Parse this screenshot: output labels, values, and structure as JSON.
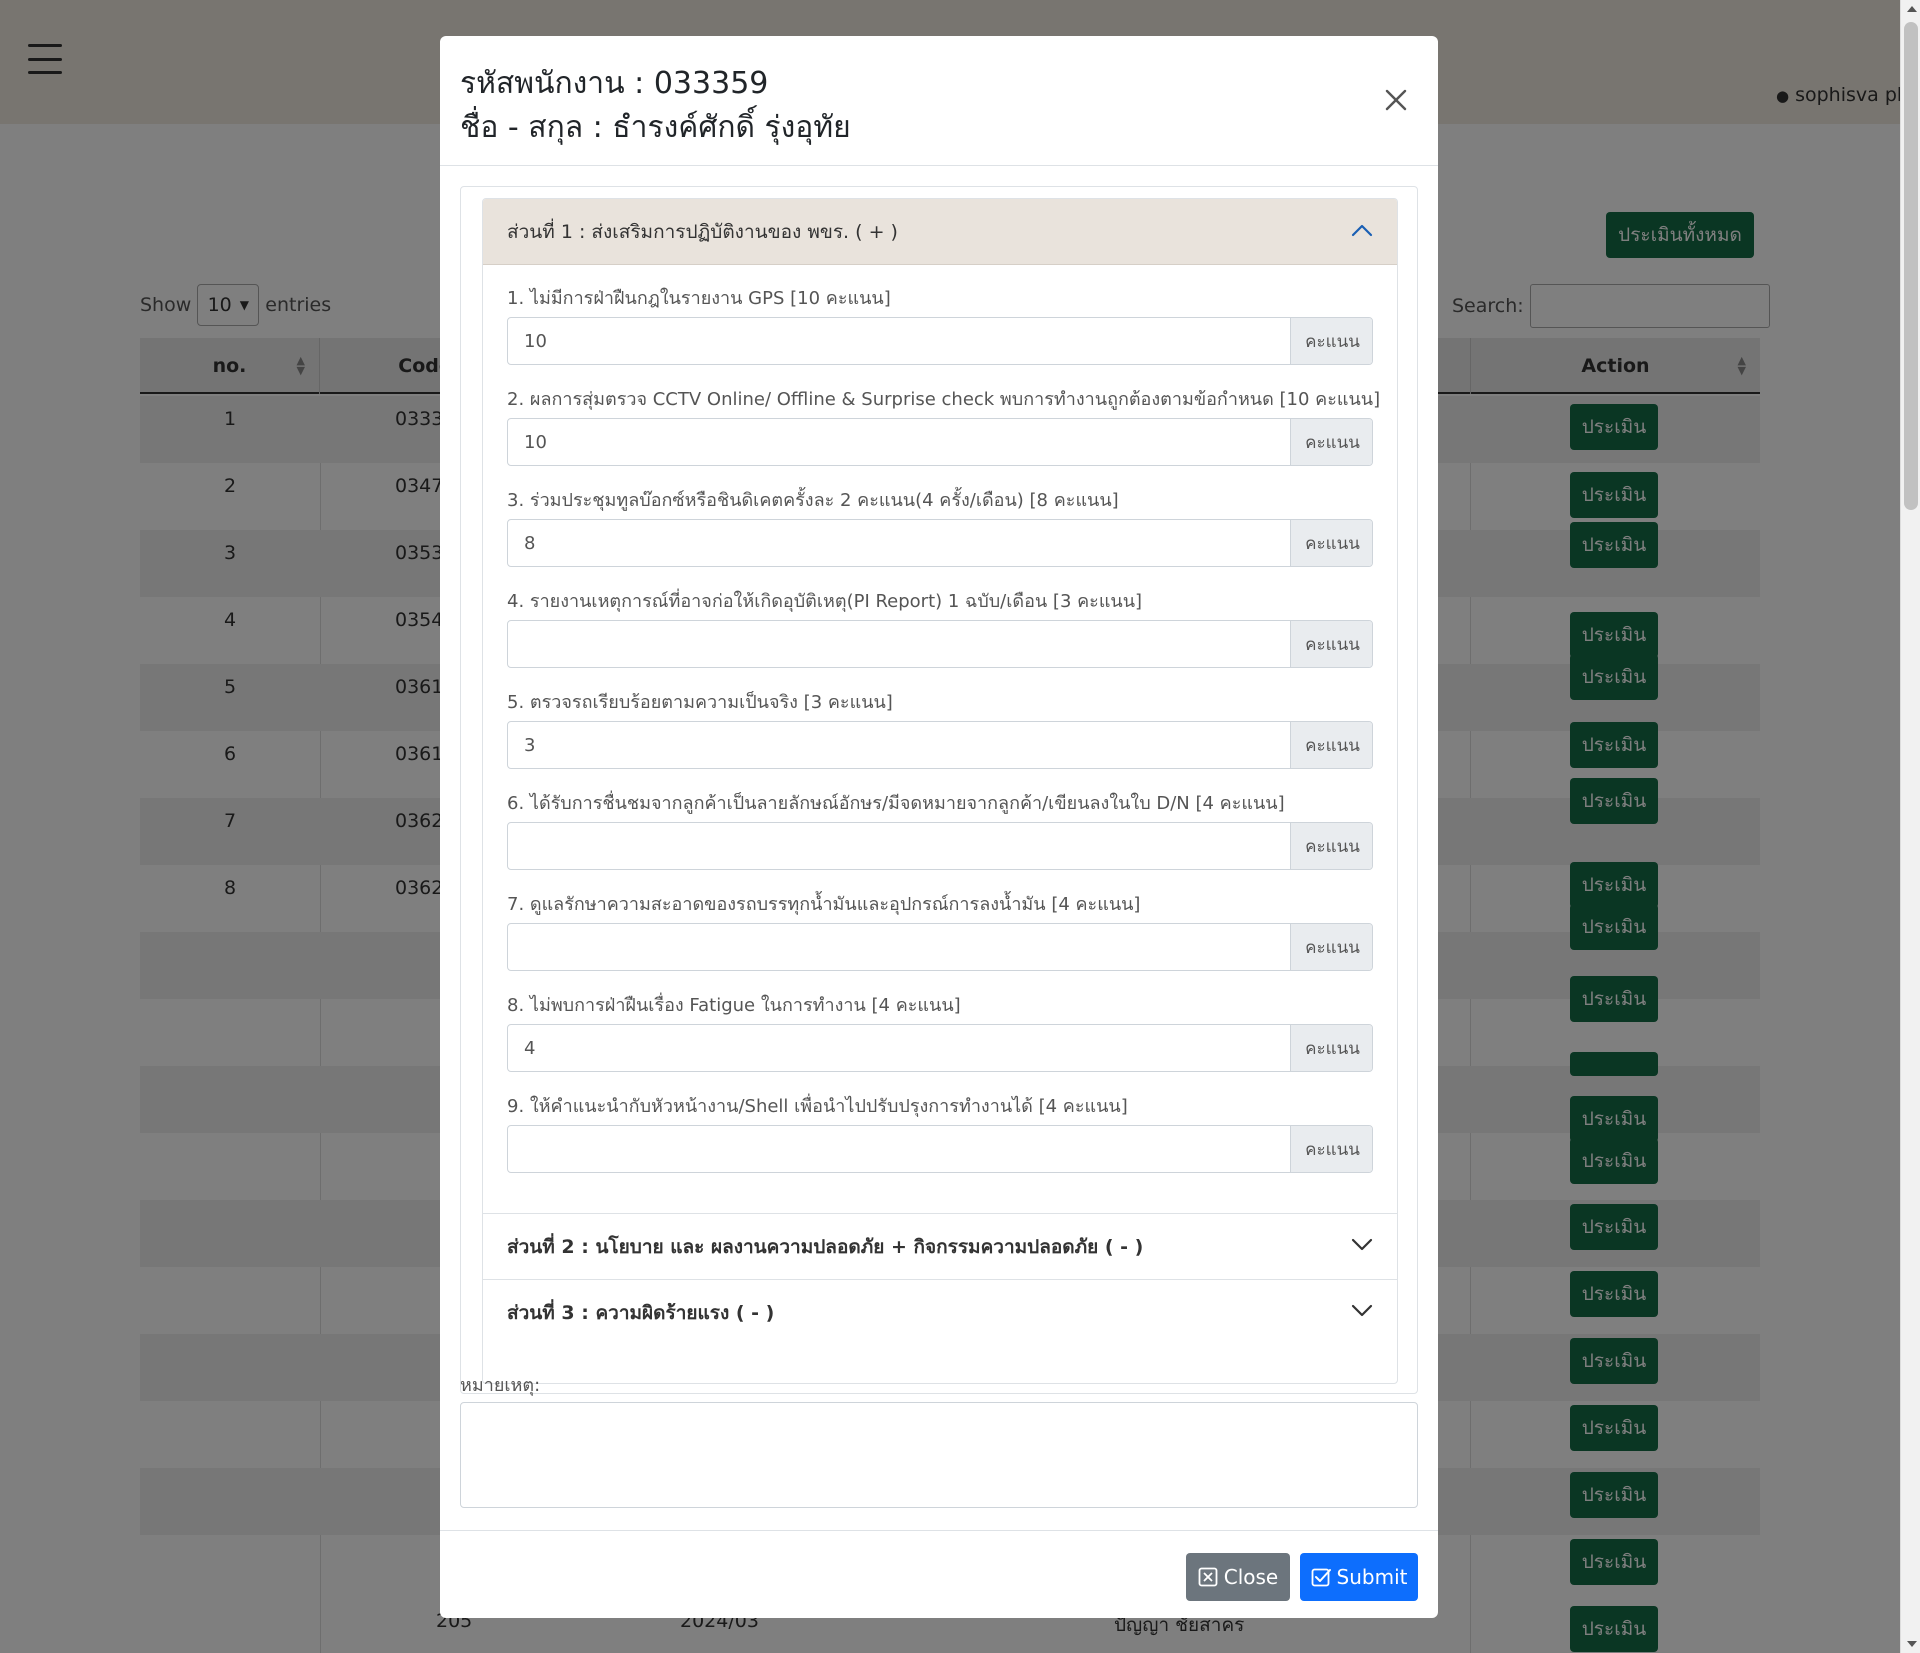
{
  "page": {
    "user_name": "sophisva ph",
    "evaluate_all_label": "ประเมินทั้งหมด",
    "show_label": "Show",
    "entries_value": "10",
    "entries_label": "entries",
    "search_label": "Search:",
    "columns": {
      "no": "no.",
      "code": "Code",
      "action": "Action"
    },
    "rows": [
      {
        "no": "1",
        "code": "0333"
      },
      {
        "no": "2",
        "code": "0347"
      },
      {
        "no": "3",
        "code": "0353"
      },
      {
        "no": "4",
        "code": "0354"
      },
      {
        "no": "5",
        "code": "0361"
      },
      {
        "no": "6",
        "code": "0361"
      },
      {
        "no": "7",
        "code": "0362"
      },
      {
        "no": "8",
        "code": "0362"
      }
    ],
    "action_label": "ประเมิน",
    "bottom_row": {
      "no": "205",
      "period": "2024/03",
      "name": "ปัญญา ชัยสาคร"
    }
  },
  "modal": {
    "employee_id_label": "รหัสพนักงาน :",
    "employee_id": "033359",
    "name_label": "ชื่อ - สกุล :",
    "name": "ธำรงค์ศักดิ์ รุ่งอุทัย",
    "section1_title": "ส่วนที่ 1 : ส่งเสริมการปฏิบัติงานของ พขร. ( + )",
    "section2_title": "ส่วนที่ 2 : นโยบาย และ ผลงานความปลอดภัย + กิจกรรมความปลอดภัย ( - )",
    "section3_title": "ส่วนที่ 3 : ความผิดร้ายแรง ( - )",
    "unit": "คะแนน",
    "questions": [
      {
        "label": "1. ไม่มีการฝ่าฝืนกฎในรายงาน GPS [10 คะแนน]",
        "value": "10"
      },
      {
        "label": "2. ผลการสุ่มตรวจ CCTV Online/ Offline & Surprise check พบการทำงานถูกต้องตามข้อกำหนด [10 คะแนน]",
        "value": "10"
      },
      {
        "label": "3. ร่วมประชุมทูลบ๊อกซ์หรือชินดิเคตครั้งละ 2 คะแนน(4 ครั้ง/เดือน) [8 คะแนน]",
        "value": "8"
      },
      {
        "label": "4. รายงานเหตุการณ์ที่อาจก่อให้เกิดอุบัติเหตุ(PI Report) 1 ฉบับ/เดือน [3 คะแนน]",
        "value": ""
      },
      {
        "label": "5. ตรวจรถเรียบร้อยตามความเป็นจริง [3 คะแนน]",
        "value": "3"
      },
      {
        "label": "6. ได้รับการชื่นชมจากลูกค้าเป็นลายลักษณ์อักษร/มีจดหมายจากลูกค้า/เขียนลงในใบ D/N [4 คะแนน]",
        "value": ""
      },
      {
        "label": "7. ดูแลรักษาความสะอาดของรถบรรทุกน้ำมันและอุปกรณ์การลงน้ำมัน [4 คะแนน]",
        "value": ""
      },
      {
        "label": "8. ไม่พบการฝ่าฝืนเรื่อง Fatigue ในการทำงาน [4 คะแนน]",
        "value": "4"
      },
      {
        "label": "9. ให้คำแนะนำกับหัวหน้างาน/Shell เพื่อนำไปปรับปรุงการทำงานได้ [4 คะแนน]",
        "value": ""
      }
    ],
    "remark_label": "หมายเหตุ:",
    "close_label": "Close",
    "submit_label": "Submit"
  },
  "colors": {
    "accent_green": "#156c46",
    "submit_blue": "#0d6efd",
    "close_gray": "#6c757d",
    "section_header": "#e9e3dc"
  }
}
